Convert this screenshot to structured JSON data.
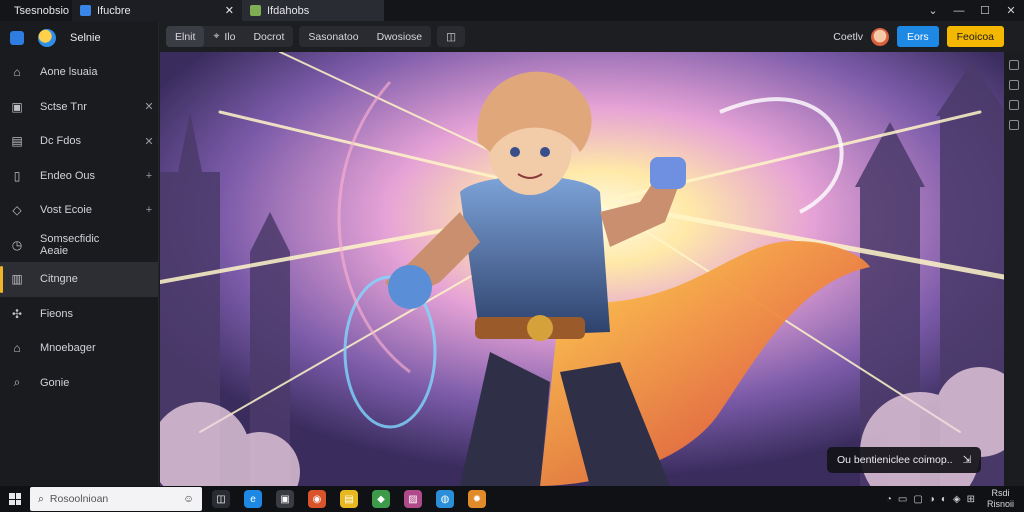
{
  "window": {
    "tabs": [
      {
        "label": "Tsesnobsio",
        "icon": "app-logo-icon"
      },
      {
        "label": "Ifucbre",
        "icon": "browser-icon",
        "close": "✕"
      },
      {
        "label": "Ifdahobs",
        "icon": "image-file-icon"
      }
    ],
    "controls": {
      "chevron": "⌄",
      "minimize": "—",
      "maximize": "☐",
      "close": "✕"
    }
  },
  "sidebar": {
    "title": "Selnie",
    "items": [
      {
        "label": "Aone lsuaia",
        "icon": "home-icon",
        "side": ""
      },
      {
        "label": "Sctse Tnr",
        "icon": "image-icon",
        "side": "✕"
      },
      {
        "label": "Dc Fdos",
        "icon": "folder-icon",
        "side": "✕"
      },
      {
        "label": "Endeo Ous",
        "icon": "document-icon",
        "side": "+"
      },
      {
        "label": "Vost Ecoie",
        "icon": "tag-icon",
        "side": "+"
      },
      {
        "label": "Somsecfidic Aeaie",
        "icon": "clock-icon",
        "side": ""
      },
      {
        "label": "Citngne",
        "icon": "library-icon",
        "side": "",
        "active": true
      },
      {
        "label": "Fieons",
        "icon": "plugin-icon",
        "side": ""
      },
      {
        "label": "Mnoebager",
        "icon": "inbox-icon",
        "side": ""
      },
      {
        "label": "Gonie",
        "icon": "search-icon",
        "side": ""
      }
    ]
  },
  "toolbar": {
    "tabs": [
      "Elnit",
      "Ilo",
      "Docrot"
    ],
    "filters": [
      "Sasonatoo",
      "Dwosiose"
    ],
    "user_label": "Coetlv",
    "primary_button": "Eors",
    "secondary_button": "Feoicoa"
  },
  "canvas": {
    "toast_text": "Ou bentieniclee coimop..",
    "toast_icon": "export-icon"
  },
  "taskbar": {
    "search_placeholder": "Rosoolnioan",
    "clock_time": "Rsdi",
    "clock_date": "Risnoii",
    "apps": [
      "task-view-icon",
      "edge-icon",
      "store-icon",
      "chrome-icon",
      "explorer-icon",
      "maps-icon",
      "photos-icon",
      "browser-icon",
      "game-icon"
    ]
  },
  "colors": {
    "accent_yellow": "#f5b800",
    "accent_blue": "#1e88e5",
    "active_bar": "#f0b429"
  }
}
